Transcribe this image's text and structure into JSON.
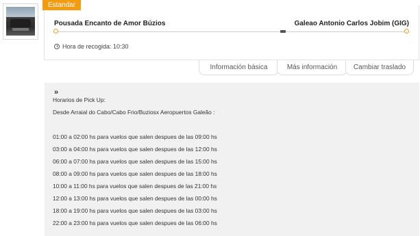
{
  "badge": "Estandar",
  "route": {
    "origin": "Pousada Encanto de Amor Búzios",
    "destination": "Galeao Antonio Carlos Jobim (GIG)",
    "pickup_time": "Hora de recogida: 10:30"
  },
  "tabs": [
    "Información básica",
    "Más información",
    "Cambiar traslado"
  ],
  "info": {
    "chevron": "»",
    "heading": "Horarios de Pick Up:",
    "subheading": "Desde Arraial do Cabo/Cabo Frio/Buziosx Aeropuertos Galeão :",
    "schedule": [
      " 01:00 a 02:00 hs para vuelos que salen despues de las 09:00 hs",
      "03:00 a 04:00 hs para vuelos que salen despues de las 12:00 hs",
      "06:00 a 07:00 hs para vuelos que salen despues de las 15:00 hs",
      "08:00 a 09:00 hs para vuelos que salen despues de las 18:00 hs",
      "10:00 a 11:00 hs para vuelos que salen despues de las 21:00 hs",
      "12:00 a 13:00 hs para vuelos que salen despues de las 00:00 hs",
      "18:00 a 19:00 hs para vuelos que salen despues de las 03:00 hs",
      "22:00 a 23:00 hs para vuelos que salen despues de las 06:00 hs"
    ]
  },
  "colors": {
    "accent": "#f39c12",
    "panel": "#f1f1f1"
  }
}
